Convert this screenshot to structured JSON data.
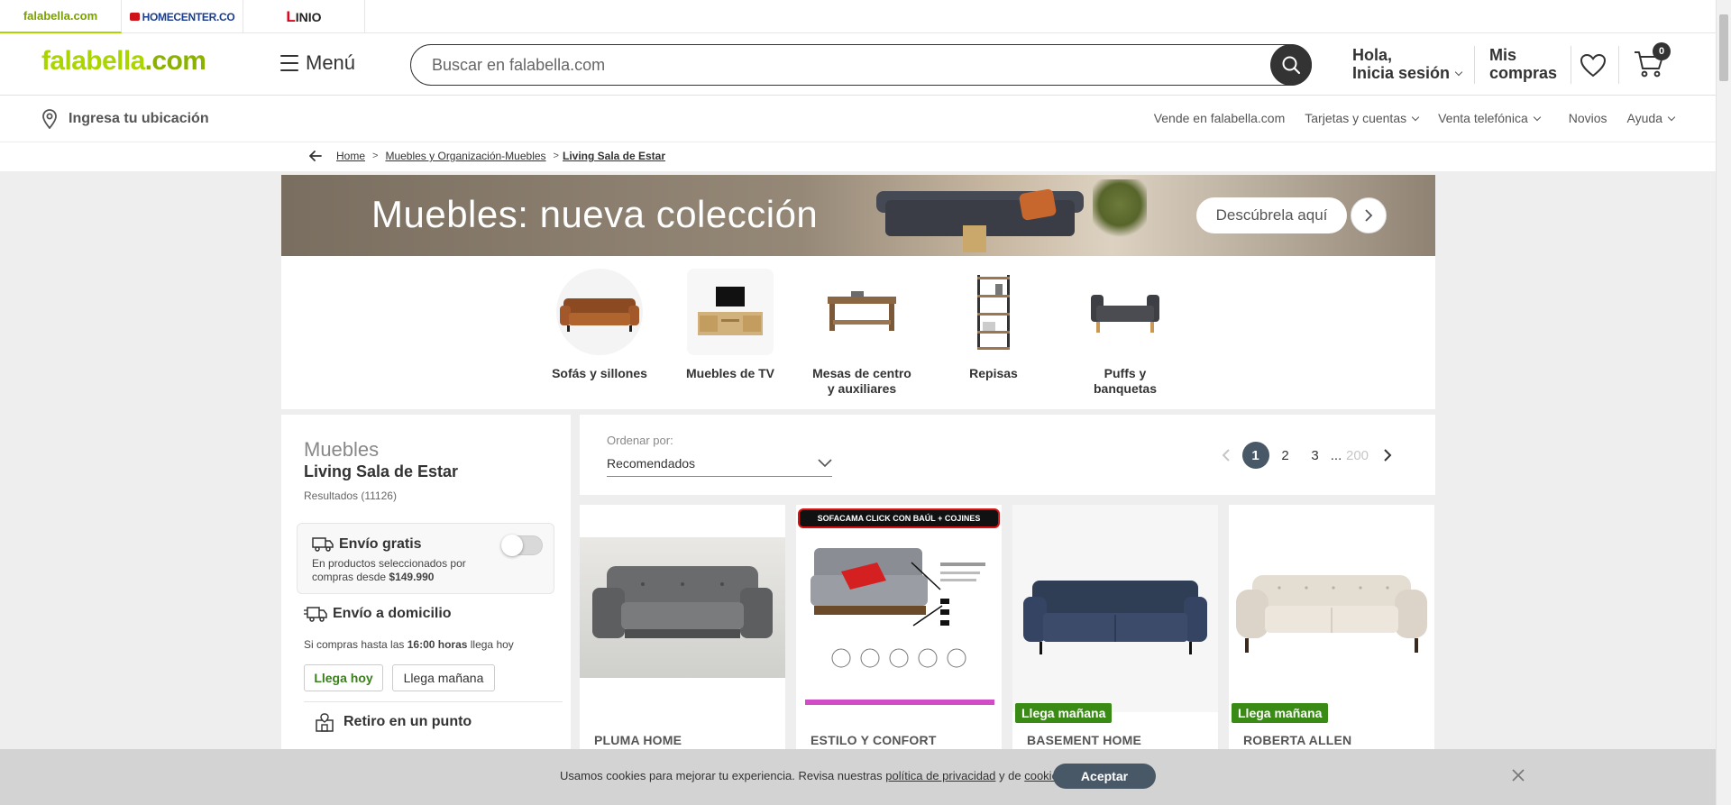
{
  "brands": {
    "falabella": "falabella.com",
    "homecenter": "HOMECENTER.CO",
    "linio_l": "L",
    "linio_rest": "INIO"
  },
  "header": {
    "logo_main": "falabella",
    "logo_suffix": ".com",
    "menu_label": "Menú",
    "search_placeholder": "Buscar en falabella.com",
    "greeting_line1": "Hola,",
    "greeting_line2": "Inicia sesión",
    "orders_line1": "Mis",
    "orders_line2": "compras",
    "cart_count": "0"
  },
  "subbar": {
    "location": "Ingresa tu ubicación",
    "nav": [
      {
        "label": "Vende en falabella.com",
        "has_chevron": false
      },
      {
        "label": "Tarjetas y cuentas",
        "has_chevron": true
      },
      {
        "label": "Venta telefónica",
        "has_chevron": true
      },
      {
        "label": "Novios",
        "has_chevron": false
      },
      {
        "label": "Ayuda",
        "has_chevron": true
      }
    ]
  },
  "breadcrumb": {
    "items": [
      "Home",
      "Muebles y Organización-Muebles"
    ],
    "sep": ">",
    "current": "Living Sala de Estar"
  },
  "banner": {
    "title": "Muebles: nueva colección",
    "cta": "Descúbrela aquí"
  },
  "categories": [
    {
      "label_1": "Sofás y sillones",
      "label_2": "",
      "icon": "sofa-icon"
    },
    {
      "label_1": "Muebles de TV",
      "label_2": "",
      "icon": "tv-stand-icon"
    },
    {
      "label_1": "Mesas de centro",
      "label_2": "y auxiliares",
      "icon": "coffee-table-icon"
    },
    {
      "label_1": "Repisas",
      "label_2": "",
      "icon": "shelf-icon"
    },
    {
      "label_1": "Puffs y",
      "label_2": "banquetas",
      "icon": "bench-icon"
    }
  ],
  "sidebar": {
    "category": "Muebles",
    "subcategory": "Living Sala de Estar",
    "results": "Resultados (11126)",
    "free_shipping": {
      "title": "Envío gratis",
      "desc_line1": "En productos seleccionados por",
      "desc_line2_prefix": "compras desde ",
      "desc_line2_amount": "$149.990",
      "enabled": false
    },
    "home_delivery": {
      "title": "Envío a domicilio",
      "desc_prefix": "Si compras hasta las ",
      "desc_time": "16:00 horas",
      "desc_suffix": " llega hoy",
      "chip_today": "Llega hoy",
      "chip_tomorrow": "Llega mañana"
    },
    "pickup": {
      "title": "Retiro en un punto"
    }
  },
  "sort": {
    "label": "Ordenar por:",
    "value": "Recomendados"
  },
  "pagination": {
    "pages": [
      "1",
      "2",
      "3"
    ],
    "current": "1",
    "ellipsis": "...",
    "last": "200"
  },
  "products": [
    {
      "brand": "PLUMA HOME",
      "badge": ""
    },
    {
      "brand": "ESTILO Y CONFORT",
      "badge": "",
      "image_banner": "SOFACAMA CLICK CON BAÚL + COJINES"
    },
    {
      "brand": "BASEMENT HOME",
      "badge": "Llega mañana"
    },
    {
      "brand": "ROBERTA ALLEN",
      "badge": "Llega mañana"
    }
  ],
  "cookie": {
    "text_prefix": "Usamos cookies para mejorar tu experiencia. Revisa nuestras ",
    "privacy_link": "política de privacidad",
    "middle": " y de ",
    "cookies_link": "cookies",
    "suffix": ".",
    "accept": "Aceptar"
  },
  "colors": {
    "brand_green": "#aad500",
    "dark": "#333333",
    "badge_green": "#3a8b16",
    "pager_active": "#495867"
  }
}
